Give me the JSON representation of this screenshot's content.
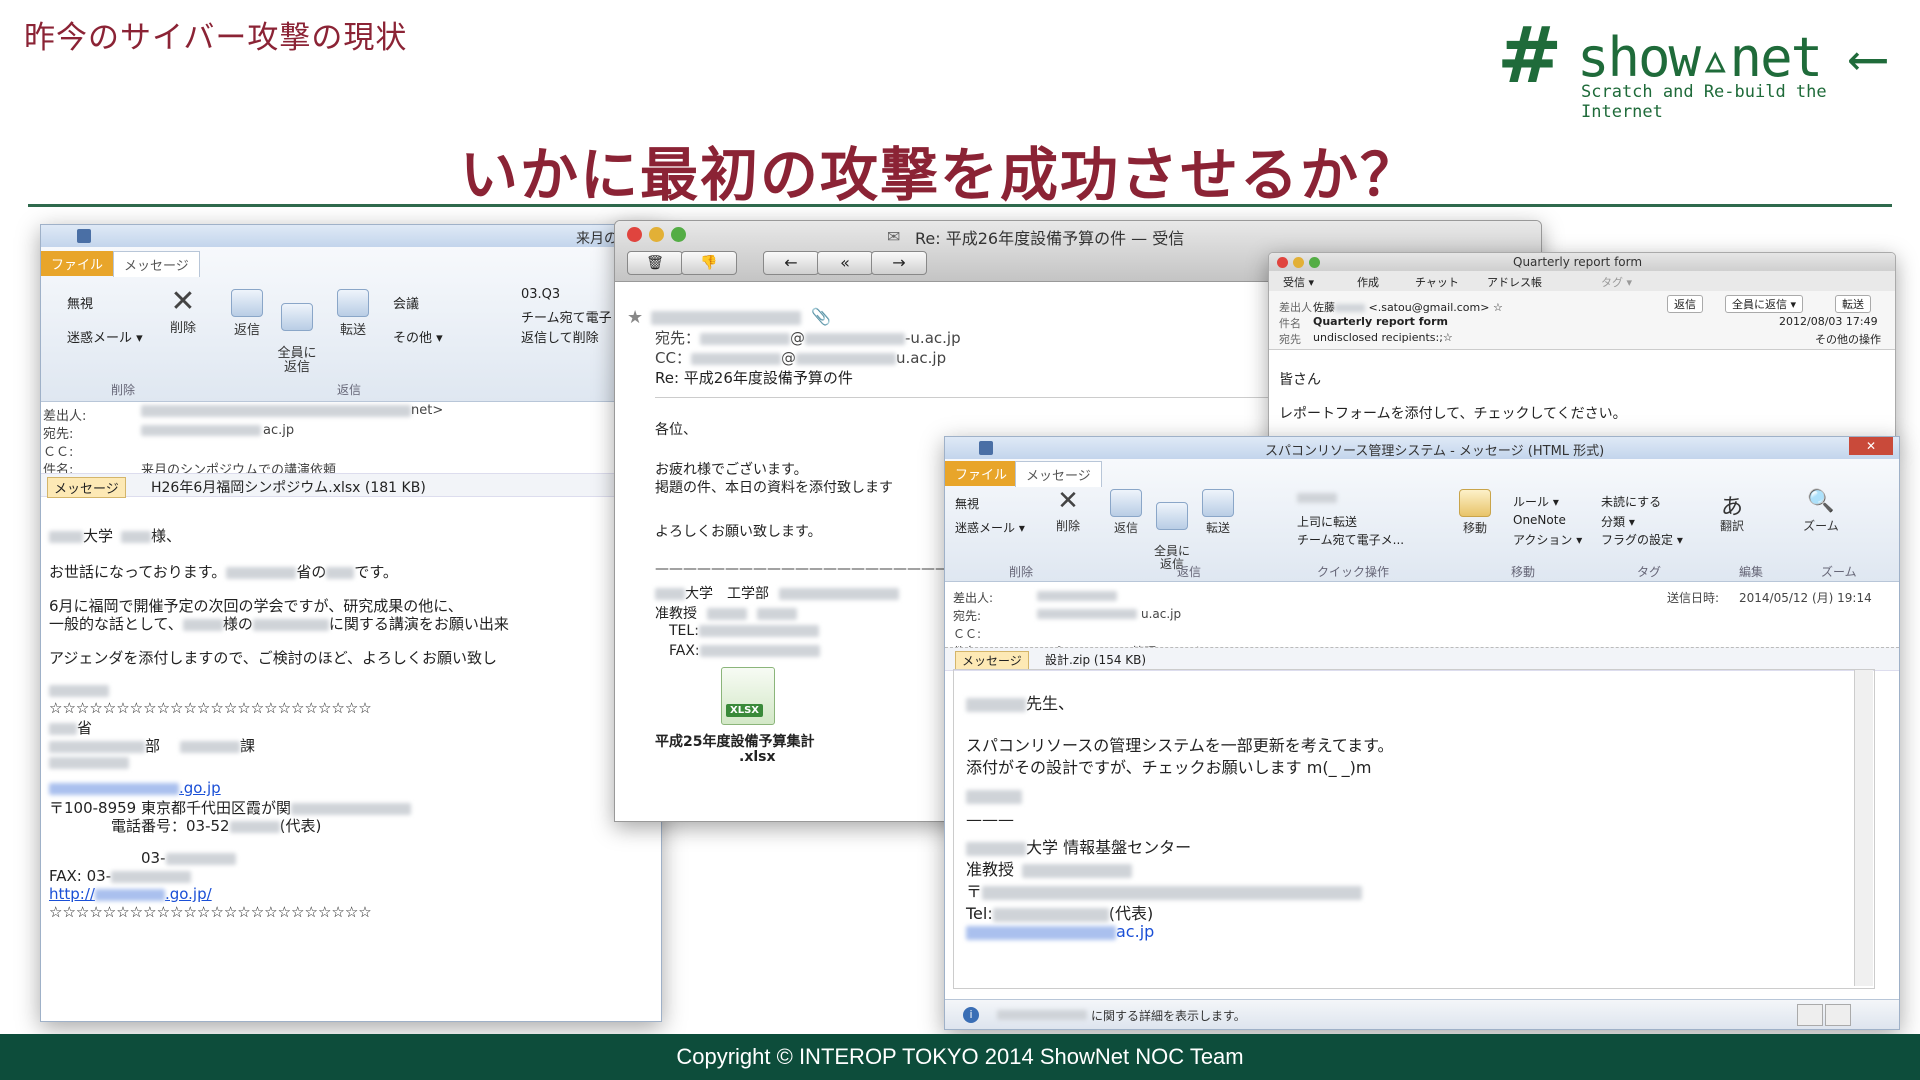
{
  "slide": {
    "section_title": "昨今のサイバー攻撃の現状",
    "main_title": "いかに最初の攻撃を成功させるか？",
    "logo": {
      "hash": "#",
      "text": "show▵net ⟵",
      "subtitle": "Scratch and Re-build the Internet"
    },
    "footer": "Copyright © INTEROP TOKYO 2014 ShowNet NOC Team"
  },
  "win1": {
    "title": "来月の",
    "tabs": [
      "ファイル",
      "メッセージ"
    ],
    "buttons": {
      "ignore": "無視",
      "junk": "迷惑メール ▾",
      "delete": "削除",
      "reply": "返信",
      "reply_all": "全員に\n返信",
      "forward": "転送",
      "meeting": "会議",
      "more": "その他 ▾"
    },
    "quick": [
      "03.Q3",
      "チーム宛て電子",
      "返信して削除"
    ],
    "groups": [
      "削除",
      "返信"
    ],
    "headers": {
      "from": "差出人:",
      "from_tail": "net>",
      "to": "宛先:",
      "to_tail": "ac.jp",
      "cc": "ＣＣ:",
      "subject": "件名:",
      "subject_val": "来月のシンポジウムでの講演依頼"
    },
    "attach": {
      "msg": "メッセージ",
      "file": "H26年6月福岡シンポジウム.xlsx (181 KB)"
    },
    "body": {
      "l1a": "大学",
      "l1b": "様、",
      "l2a": "お世話になっております。",
      "l2b": "省の",
      "l2c": "です。",
      "l3": "6月に福岡で開催予定の次回の学会ですが、研究成果の他に、",
      "l4a": "一般的な話として、",
      "l4b": "様の",
      "l4c": "に関する講演をお願い出来",
      "l5": "アジェンダを添付しますので、ご検討のほど、よろしくお願い致し",
      "stars": "☆☆☆☆☆☆☆☆☆☆☆☆☆☆☆☆☆☆☆☆☆☆☆☆",
      "sig1": "省",
      "sig2a": "部",
      "sig2b": "課",
      "sig3": ".go.jp",
      "sig4a": "〒100-8959 東京都千代田区霞が関",
      "sig5a": "電話番号：03-52",
      "sig5b": "(代表)",
      "sig6": "03-",
      "sig7": "FAX: 03-",
      "sig8a": "http://",
      "sig8b": ".go.jp/",
      "stars2": "☆☆☆☆☆☆☆☆☆☆☆☆☆☆☆☆☆☆☆☆☆☆☆☆"
    }
  },
  "win2": {
    "title": "Re: 平成26年度設備予算の件 — 受信",
    "to_label": "宛先：",
    "to_at": "@",
    "to_tail": "-u.ac.jp",
    "cc_label": "CC：",
    "cc_at": "@",
    "cc_tail": "u.ac.jp",
    "subject": "Re: 平成26年度設備予算の件",
    "body": {
      "l1": "各位、",
      "l2": "お疲れ様でございます。",
      "l3": "掲題の件、本日の資料を添付致します",
      "l4": "よろしくお願い致します。",
      "rule": "———————————————————————",
      "s1a": "大学　工学部",
      "s2a": "准教授",
      "s3": "TEL:",
      "s4": "FAX:"
    },
    "attach_icon_text": "XLSX",
    "attach_name1": "平成25年度設備予算集計",
    "attach_name2": ".xlsx"
  },
  "win3": {
    "title": "Quarterly report form",
    "toolbar": [
      "受信 ▾",
      "作成",
      "チャット",
      "アドレス帳",
      "タグ ▾"
    ],
    "from_label": "差出人",
    "from_val": "佐藤",
    "from_mail": "<.satou@gmail.com> ☆",
    "subject_label": "件名",
    "subject_val": "Quarterly report form",
    "to_label": "宛先",
    "to_val": "undisclosed recipients:;☆",
    "reply": "返信",
    "reply_all": "全員に返信 ▾",
    "forward": "転送",
    "date": "2012/08/03 17:49",
    "other": "その他の操作",
    "body1": "皆さん",
    "body2": "レポートフォームを添付して、チェックしてください。"
  },
  "win4": {
    "title": "スパコンリソース管理システム - メッセージ (HTML 形式)",
    "tabs": [
      "ファイル",
      "メッセージ"
    ],
    "buttons": {
      "ignore": "無視",
      "junk": "迷惑メール ▾",
      "delete": "削除",
      "reply": "返信",
      "reply_all": "全員に\n返信",
      "forward": "転送"
    },
    "quick": [
      "上司に転送",
      "チーム宛て電子メ..."
    ],
    "move": "移動",
    "rules": [
      "ルール ▾",
      "OneNote",
      "アクション ▾"
    ],
    "tags": [
      "未読にする",
      "分類 ▾",
      "フラグの設定 ▾"
    ],
    "translate": "翻訳",
    "zoom": "ズーム",
    "groups": [
      "削除",
      "返信",
      "クイック操作",
      "移動",
      "タグ",
      "編集",
      "ズーム"
    ],
    "headers": {
      "from": "差出人:",
      "to": "宛先:",
      "to_tail": "u.ac.jp",
      "cc": "ＣＣ:",
      "subject": "件名:",
      "subject_val": "スパコンリソース管理システム",
      "sent_label": "送信日時:",
      "sent_val": "2014/05/12 (月) 19:14"
    },
    "attach": {
      "msg": "メッセージ",
      "file": "設計.zip (154 KB)"
    },
    "body": {
      "l1": "先生、",
      "l2": "スパコンリソースの管理システムを一部更新を考えてます。",
      "l3": "添付がその設計ですが、チェックお願いします m(_ _)m",
      "rule": "———",
      "s1": "大学 情報基盤センター",
      "s2": "准教授",
      "s3": "〒",
      "s4a": "Tel:",
      "s4b": "(代表)",
      "s5": "ac.jp"
    },
    "status": "に関する詳細を表示します。"
  }
}
